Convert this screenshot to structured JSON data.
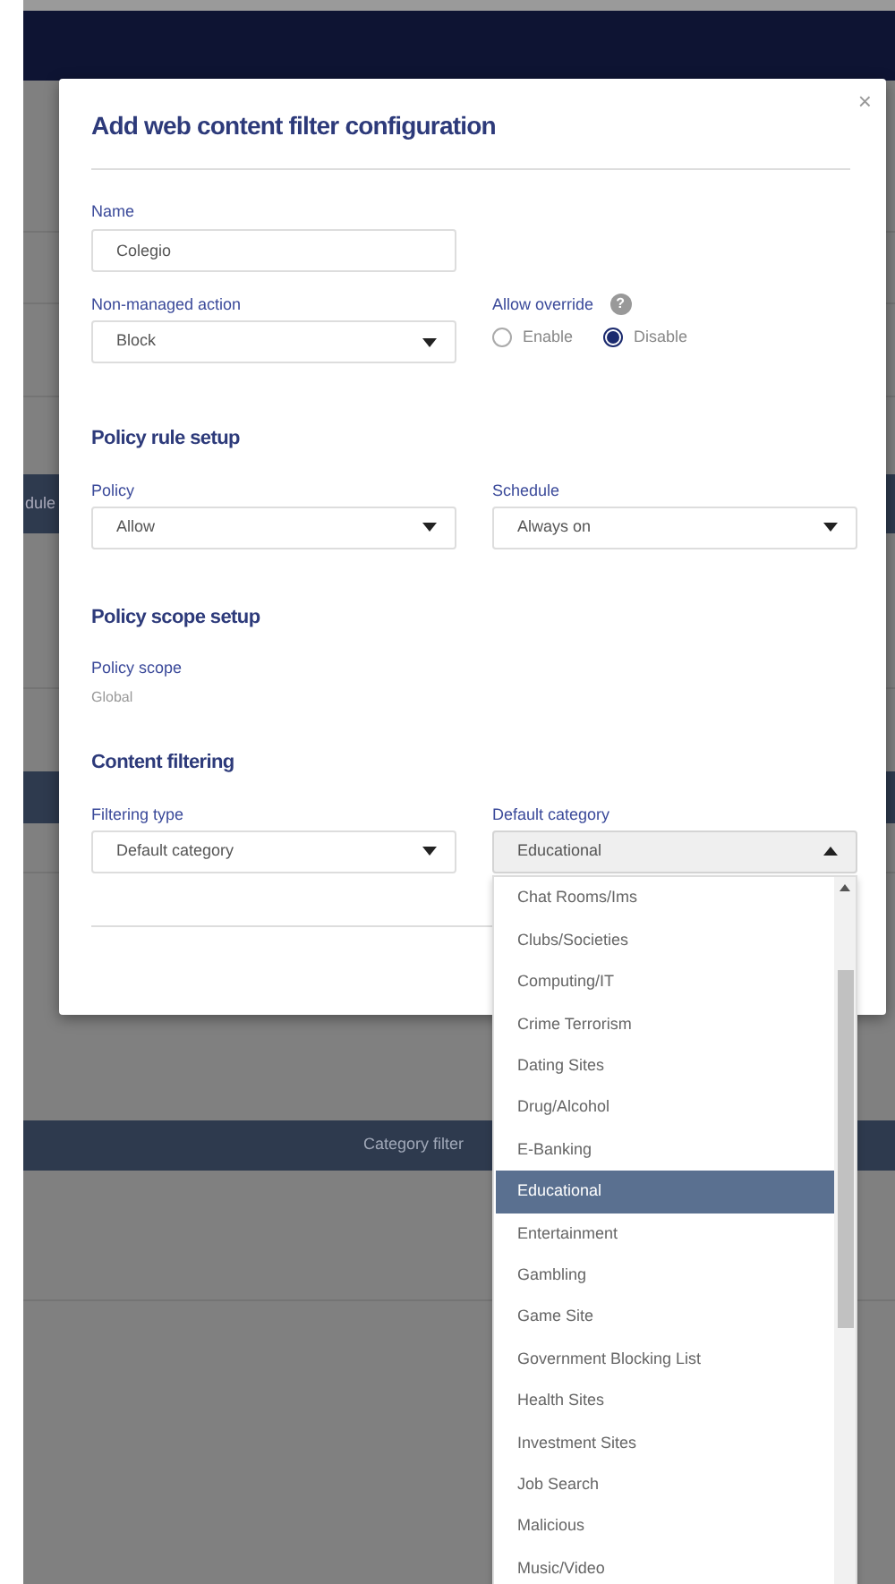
{
  "background": {
    "band_text": "dule",
    "category_band_text": "Category filter"
  },
  "dialog": {
    "title": "Add web content filter configuration",
    "close": "×",
    "name_field": {
      "label": "Name",
      "value": "Colegio"
    },
    "non_managed_action": {
      "label": "Non-managed action",
      "value": "Block",
      "expanded": false
    },
    "allow_override": {
      "label": "Allow override",
      "help": "?",
      "options": [
        {
          "label": "Enable",
          "selected": false
        },
        {
          "label": "Disable",
          "selected": true
        }
      ]
    },
    "policy_rule_setup": {
      "heading": "Policy rule setup",
      "policy": {
        "label": "Policy",
        "value": "Allow",
        "expanded": false
      },
      "schedule": {
        "label": "Schedule",
        "value": "Always on",
        "expanded": false
      }
    },
    "policy_scope_setup": {
      "heading": "Policy scope setup",
      "label": "Policy scope",
      "value": "Global"
    },
    "content_filtering": {
      "heading": "Content filtering",
      "filtering_type": {
        "label": "Filtering type",
        "value": "Default category",
        "expanded": false
      },
      "default_category": {
        "label": "Default category",
        "value": "Educational",
        "expanded": true
      }
    }
  },
  "category_list": [
    {
      "label": "Chat Rooms/Ims",
      "selected": false
    },
    {
      "label": "Clubs/Societies",
      "selected": false
    },
    {
      "label": "Computing/IT",
      "selected": false
    },
    {
      "label": "Crime Terrorism",
      "selected": false
    },
    {
      "label": "Dating Sites",
      "selected": false
    },
    {
      "label": "Drug/Alcohol",
      "selected": false
    },
    {
      "label": "E-Banking",
      "selected": false
    },
    {
      "label": "Educational",
      "selected": true
    },
    {
      "label": "Entertainment",
      "selected": false
    },
    {
      "label": "Gambling",
      "selected": false
    },
    {
      "label": "Game Site",
      "selected": false
    },
    {
      "label": "Government Blocking List",
      "selected": false
    },
    {
      "label": "Health Sites",
      "selected": false
    },
    {
      "label": "Investment Sites",
      "selected": false
    },
    {
      "label": "Job Search",
      "selected": false
    },
    {
      "label": "Malicious",
      "selected": false
    },
    {
      "label": "Music/Video",
      "selected": false
    }
  ]
}
